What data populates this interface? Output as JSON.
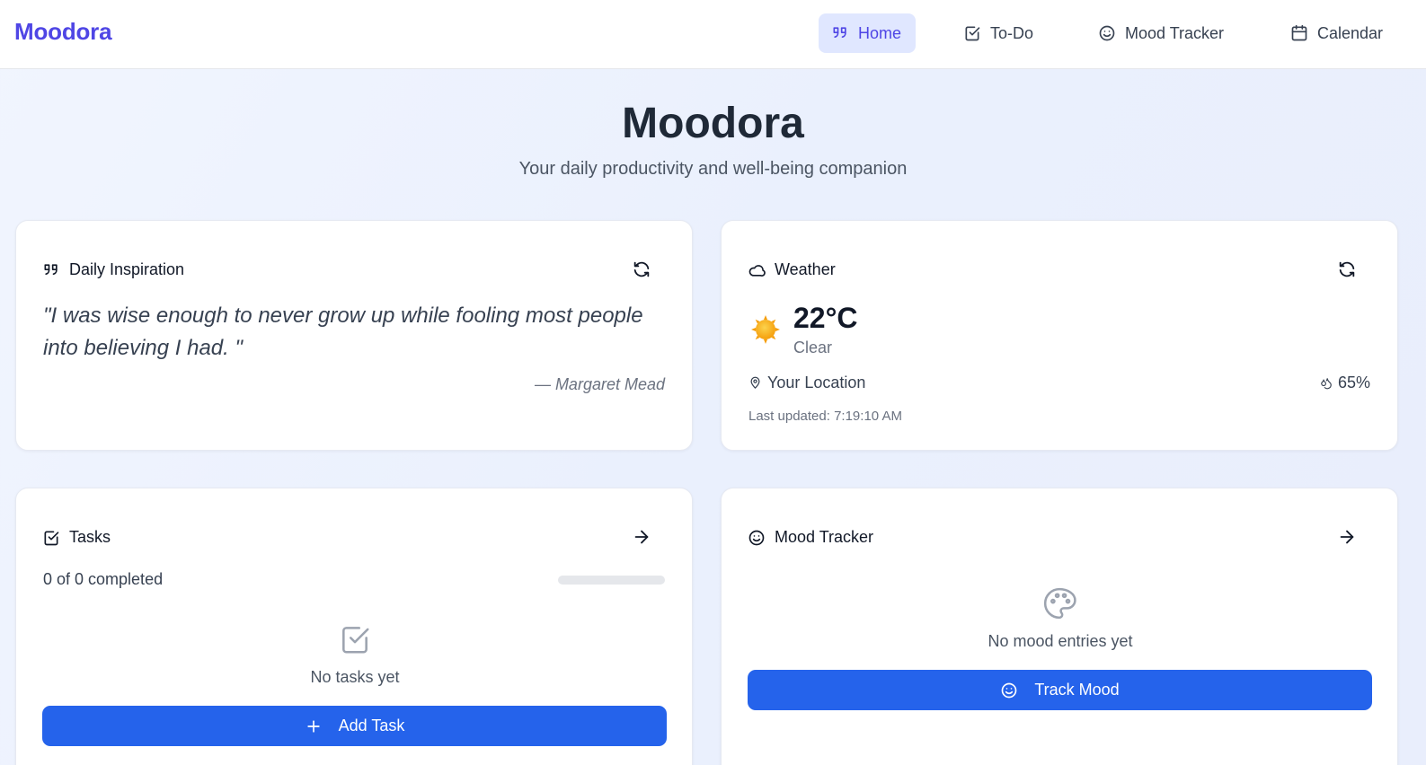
{
  "app": {
    "brand": "Moodora"
  },
  "nav": {
    "items": [
      {
        "label": "Home",
        "icon": "quote-icon",
        "active": true
      },
      {
        "label": "To-Do",
        "icon": "checkbox-icon",
        "active": false
      },
      {
        "label": "Mood Tracker",
        "icon": "smile-icon",
        "active": false
      },
      {
        "label": "Calendar",
        "icon": "calendar-icon",
        "active": false
      }
    ]
  },
  "hero": {
    "title": "Moodora",
    "subtitle": "Your daily productivity and well-being companion"
  },
  "inspiration": {
    "title": "Daily Inspiration",
    "quote": "\"I was wise enough to never grow up while fooling most people into believing I had. \"",
    "author": "— Margaret Mead"
  },
  "weather": {
    "title": "Weather",
    "temperature": "22°C",
    "condition": "Clear",
    "location": "Your Location",
    "humidity": "65%",
    "last_updated": "Last updated: 7:19:10 AM"
  },
  "tasks": {
    "title": "Tasks",
    "summary": "0 of 0 completed",
    "progress": 0,
    "empty_text": "No tasks yet",
    "add_label": "Add Task"
  },
  "mood": {
    "title": "Mood Tracker",
    "empty_text": "No mood entries yet",
    "track_label": "Track Mood"
  },
  "colors": {
    "brand": "#4f46e5",
    "primary": "#2563eb",
    "active_nav_bg": "#e0e7ff"
  }
}
